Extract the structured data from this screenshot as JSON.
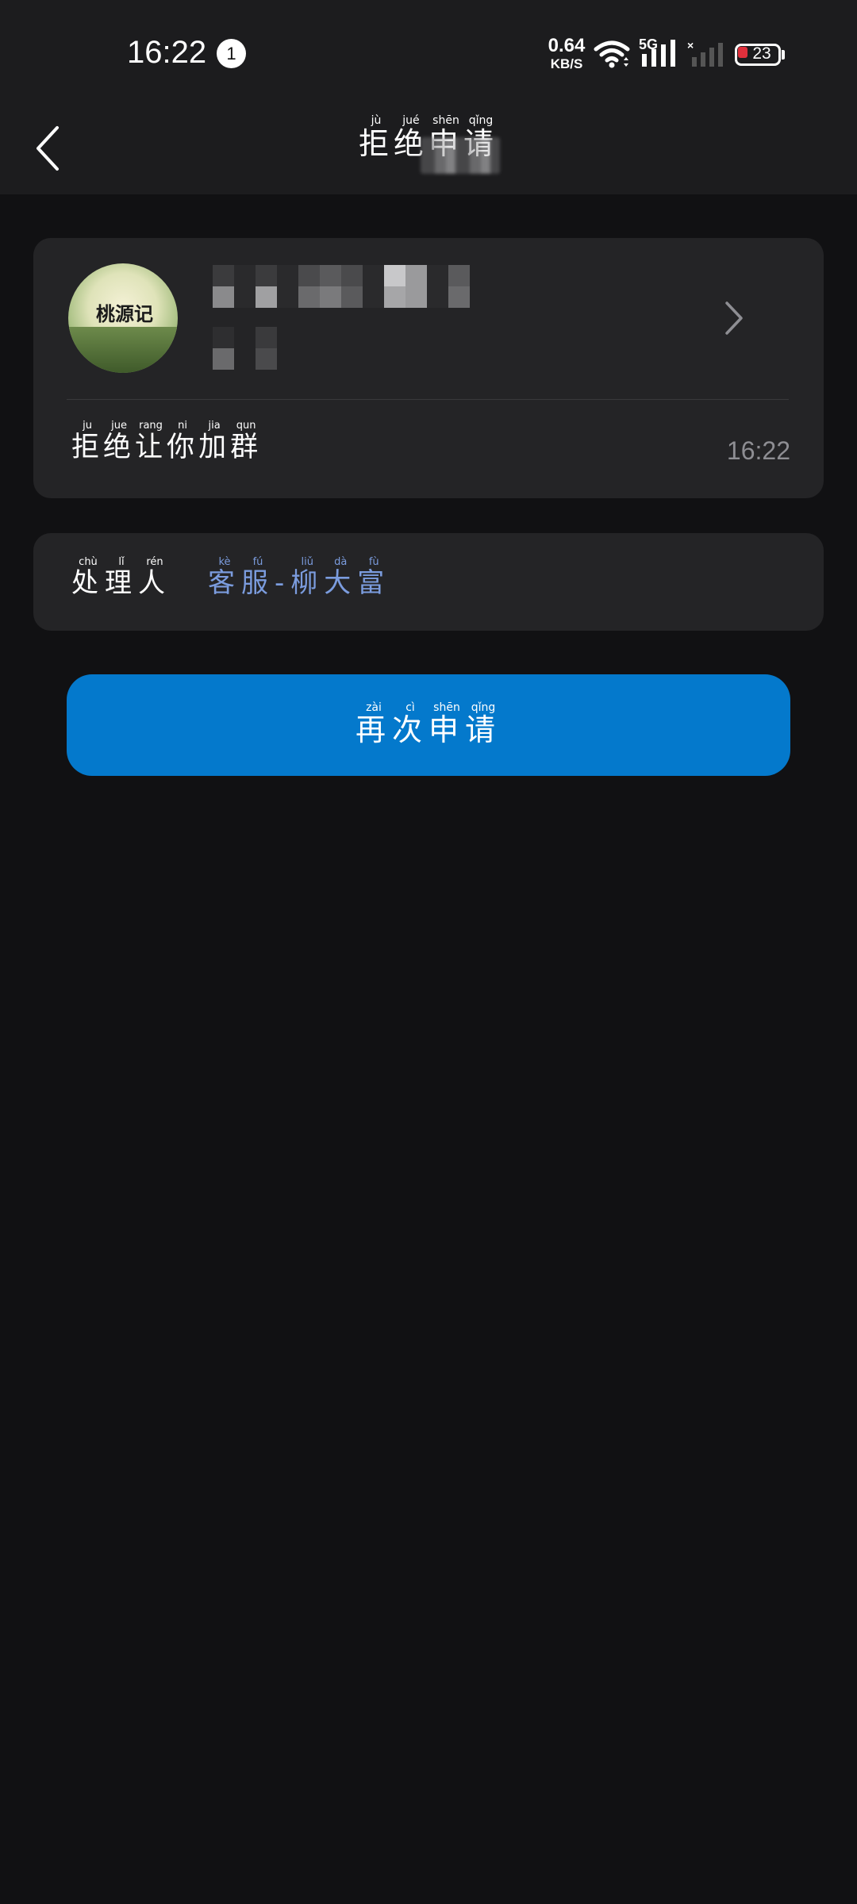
{
  "status_bar": {
    "time": "16:22",
    "notification_count": "1",
    "net_speed_value": "0.64",
    "net_speed_unit": "KB/S",
    "signal_label": "5G",
    "battery_level": "23",
    "battery_color": "#e0303c"
  },
  "nav": {
    "title_chars": [
      {
        "char": "拒",
        "pinyin": "jù"
      },
      {
        "char": "绝",
        "pinyin": "jué"
      },
      {
        "char": "申",
        "pinyin": "shēn"
      },
      {
        "char": "请",
        "pinyin": "qǐng"
      }
    ]
  },
  "request_card": {
    "reason_chars": [
      {
        "char": "拒",
        "pinyin": "ju"
      },
      {
        "char": "绝",
        "pinyin": "jue"
      },
      {
        "char": "让",
        "pinyin": "rang"
      },
      {
        "char": "你",
        "pinyin": "ni"
      },
      {
        "char": "加",
        "pinyin": "jia"
      },
      {
        "char": "群",
        "pinyin": "qun"
      }
    ],
    "time": "16:22",
    "avatar_text": "桃源记"
  },
  "handler": {
    "label_chars": [
      {
        "char": "处",
        "pinyin": "chù"
      },
      {
        "char": "理",
        "pinyin": "lǐ"
      },
      {
        "char": "人",
        "pinyin": "rén"
      }
    ],
    "name_chars": [
      {
        "char": "客",
        "pinyin": "kè"
      },
      {
        "char": "服",
        "pinyin": "fú"
      },
      {
        "char": "-",
        "pinyin": ""
      },
      {
        "char": "柳",
        "pinyin": "liǔ"
      },
      {
        "char": "大",
        "pinyin": "dà"
      },
      {
        "char": "富",
        "pinyin": "fù"
      }
    ],
    "name_color": "#7b9cde"
  },
  "reapply_button": {
    "label_chars": [
      {
        "char": "再",
        "pinyin": "zài"
      },
      {
        "char": "次",
        "pinyin": "cì"
      },
      {
        "char": "申",
        "pinyin": "shēn"
      },
      {
        "char": "请",
        "pinyin": "qǐng"
      }
    ],
    "bg_color": "#0479cc"
  }
}
